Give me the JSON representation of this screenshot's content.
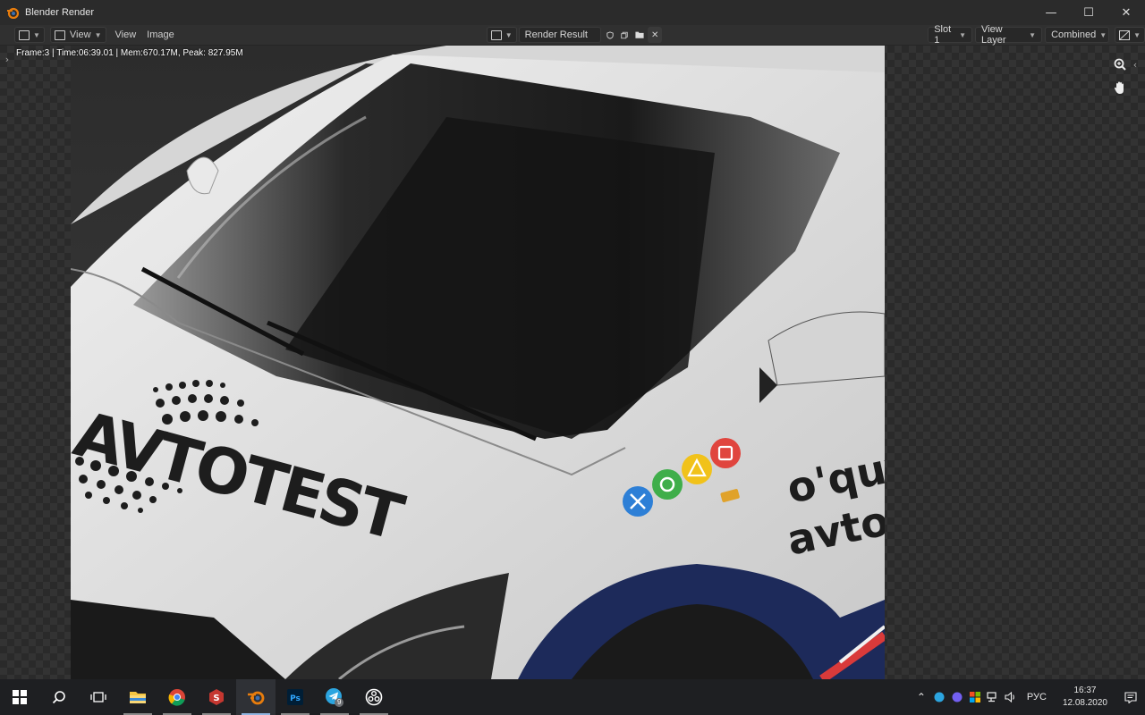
{
  "window": {
    "title": "Blender Render",
    "minimize_glyph": "—",
    "maximize_glyph": "☐",
    "close_glyph": "✕"
  },
  "header": {
    "view_menu": "View",
    "view_label": "View",
    "image_label": "Image",
    "image_name": "Render Result",
    "slot": "Slot 1",
    "view_layer": "View Layer",
    "pass": "Combined"
  },
  "viewport": {
    "stats": "Frame:3 | Time:06:39.01 | Mem:670.17M, Peak: 827.95M"
  },
  "render": {
    "hood_logo": "AVTOTEST",
    "door_text_1": "o'quv",
    "door_text_2": "avton",
    "colors": {
      "car_body": "#e4e4e4",
      "windshield": "#1b1b1b",
      "stripe_navy": "#1d2a5a",
      "stripe_red": "#d93a3a",
      "badge_blue": "#2d7fd6",
      "badge_green": "#3fae4a",
      "badge_yellow": "#f1c21a",
      "badge_red": "#e0453e"
    }
  },
  "taskbar": {
    "apps": [
      "start-icon",
      "search-icon",
      "task-view-icon",
      "file-explorer-icon",
      "chrome-icon",
      "substance-icon",
      "blender-icon",
      "photoshop-icon",
      "telegram-icon",
      "obs-icon"
    ],
    "telegram_badge": "9",
    "language": "РУС",
    "time": "16:37",
    "date": "12.08.2020"
  },
  "colors": {
    "accent": "#e87d0d",
    "header_bg": "#303030",
    "titlebar_bg": "#2b2b2b"
  }
}
